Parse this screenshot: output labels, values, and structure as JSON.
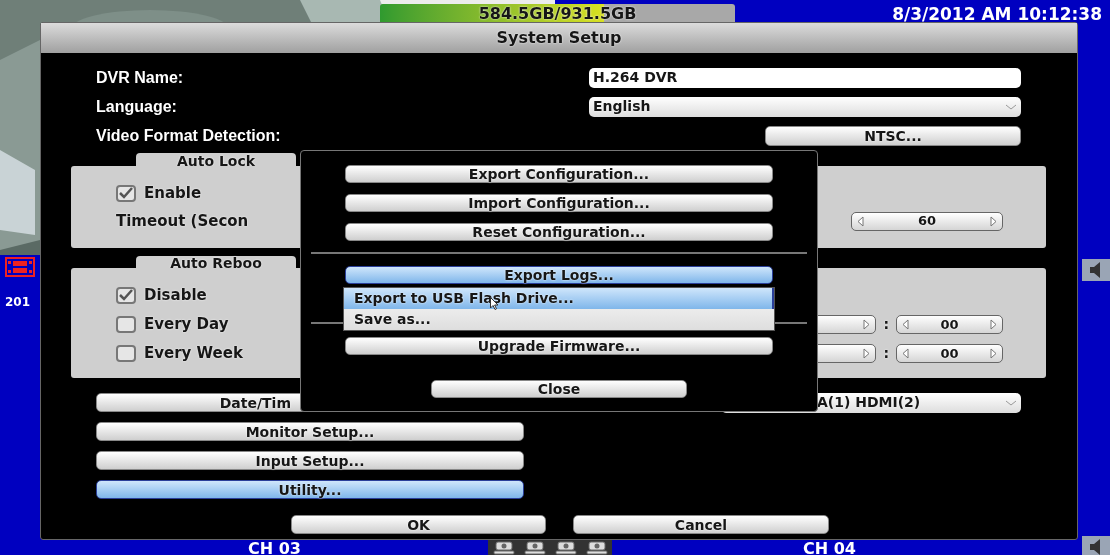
{
  "top_bar": {
    "storage": {
      "text": "584.5GB/931.5GB",
      "level": 0.63
    },
    "datetime": "8/3/2012 AM 10:12:38"
  },
  "left_overlay": "201",
  "channels": [
    "CH 03",
    "CH 04"
  ],
  "dialog": {
    "title": "System Setup",
    "fields": [
      {
        "label": "DVR Name:",
        "kind": "text",
        "value": "H.264 DVR"
      },
      {
        "label": "Language:",
        "kind": "select",
        "value": "English"
      },
      {
        "label": "Video Format Detection:",
        "kind": "button",
        "value": "NTSC..."
      }
    ],
    "auto_lock": {
      "title": "Auto Lock",
      "options": [
        {
          "label": "Enable",
          "checked": true
        }
      ],
      "timeout_label": "Timeout (Secon",
      "timeout_value": "60"
    },
    "auto_reboot": {
      "title": "Auto Reboo",
      "options": [
        {
          "label": "Disable",
          "checked": true
        },
        {
          "label": "Every Day",
          "checked": false,
          "separator": ":",
          "minute": "00"
        },
        {
          "label": "Every Week",
          "checked": false,
          "separator": ":",
          "minute": "00"
        }
      ]
    },
    "menu_buttons": [
      {
        "label": "Date/Tim",
        "selected": false
      },
      {
        "label": "Monitor Setup...",
        "selected": false
      },
      {
        "label": "Input Setup...",
        "selected": false
      },
      {
        "label": "Utility...",
        "selected": true
      }
    ],
    "output_select": "A(1)  HDMI(2)",
    "buttons": [
      "OK",
      "Cancel"
    ]
  },
  "utility_popup": {
    "sections": [
      [
        {
          "label": "Export Configuration...",
          "selected": false
        },
        {
          "label": "Import Configuration...",
          "selected": false
        },
        {
          "label": "Reset Configuration...",
          "selected": false
        }
      ],
      [
        {
          "label": "Export Logs...",
          "selected": true
        }
      ]
    ],
    "after_dropdown": [
      {
        "label": "Upgrade Firmware...",
        "selected": false
      }
    ],
    "dropdown": [
      {
        "label": "Export to USB Flash Drive...",
        "selected": true
      },
      {
        "label": "Save as...",
        "selected": false
      }
    ],
    "close": "Close"
  }
}
